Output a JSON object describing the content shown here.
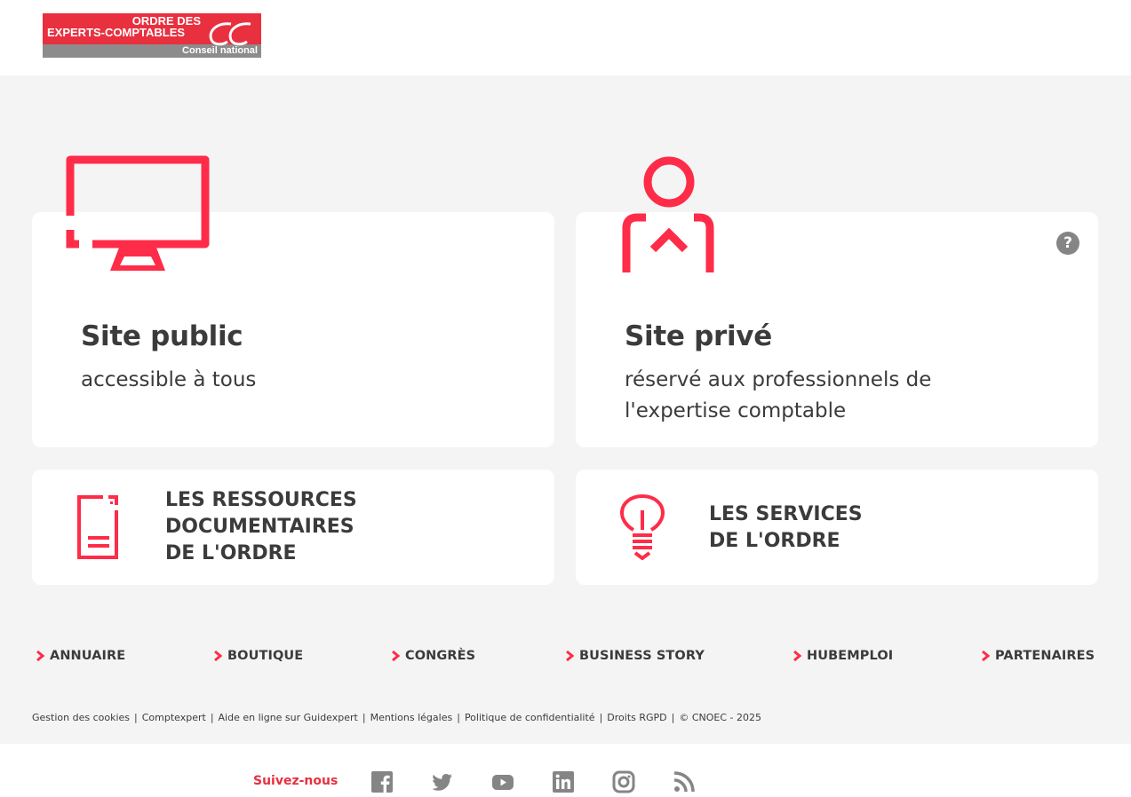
{
  "header": {
    "logo": {
      "line1": "ORDRE DES",
      "line2": "EXPERTS-COMPTABLES",
      "line3": "Conseil national"
    }
  },
  "colors": {
    "accent": "#e8303f",
    "icon_grey": "#858585",
    "text": "#3b3b3b",
    "bg": "#f4f4f4"
  },
  "cards": {
    "public": {
      "title": "Site public",
      "subtitle": "accessible à tous",
      "icon": "monitor-icon"
    },
    "prive": {
      "title": "Site privé",
      "subtitle": "réservé aux professionnels de l'expertise comptable",
      "icon": "person-icon",
      "help": "?"
    },
    "docs": {
      "line1": "LES RESSOURCES",
      "line2": "DOCUMENTAIRES",
      "line3": "DE L'ORDRE",
      "icon": "document-icon"
    },
    "services": {
      "line1": "LES SERVICES",
      "line2": "DE L'ORDRE",
      "icon": "lightbulb-icon"
    }
  },
  "nav": [
    {
      "label": "ANNUAIRE"
    },
    {
      "label": "BOUTIQUE"
    },
    {
      "label": "CONGRÈS"
    },
    {
      "label": "BUSINESS STORY"
    },
    {
      "label": "HUBEMPLOI"
    },
    {
      "label": "PARTENAIRES"
    }
  ],
  "legal": [
    "Gestion des cookies",
    "Comptexpert",
    "Aide en ligne sur Guidexpert",
    "Mentions légales",
    "Politique de confidentialité",
    "Droits RGPD",
    "© CNOEC - 2025"
  ],
  "footer": {
    "follow_label": "Suivez-nous",
    "social": [
      "facebook-icon",
      "twitter-icon",
      "youtube-icon",
      "linkedin-icon",
      "instagram-icon",
      "rss-icon"
    ]
  }
}
